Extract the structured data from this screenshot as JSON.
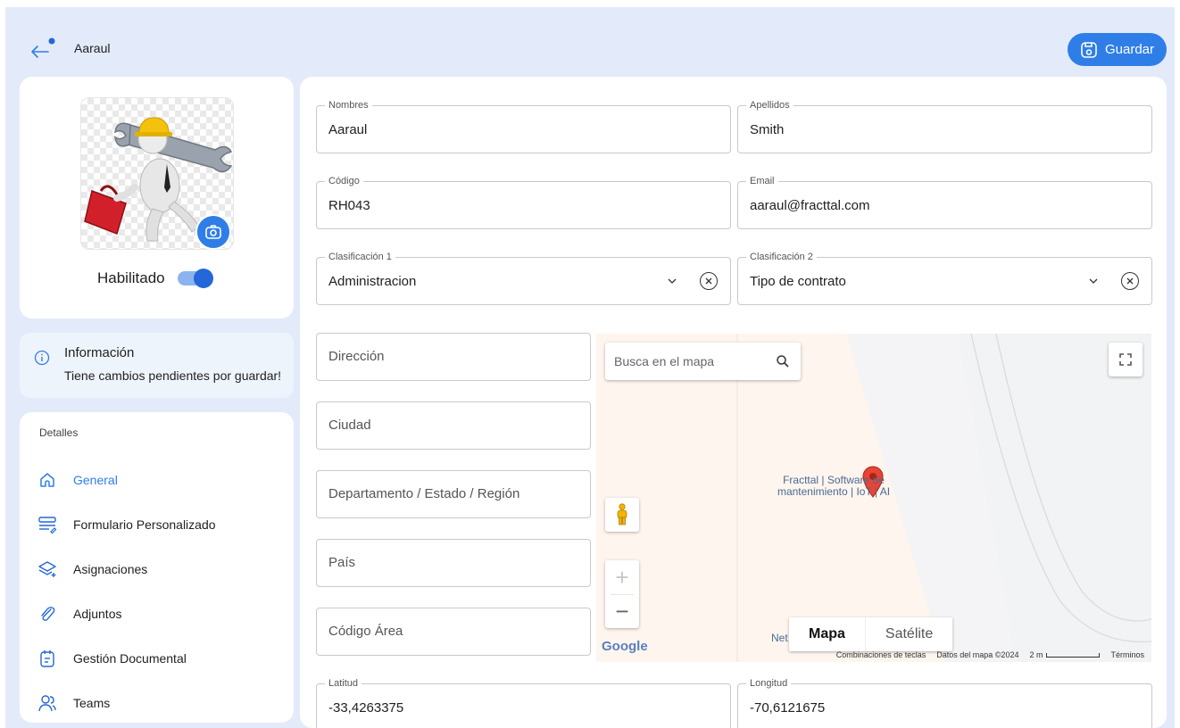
{
  "header": {
    "title": "Aaraul",
    "save_label": "Guardar"
  },
  "profile": {
    "enabled_label": "Habilitado",
    "enabled": true
  },
  "info": {
    "title": "Información",
    "text": "Tiene cambios pendientes por guardar!"
  },
  "nav": {
    "heading": "Detalles",
    "items": [
      {
        "label": "General",
        "icon": "home-icon",
        "active": true
      },
      {
        "label": "Formulario Personalizado",
        "icon": "form-icon",
        "active": false
      },
      {
        "label": "Asignaciones",
        "icon": "layers-icon",
        "active": false
      },
      {
        "label": "Adjuntos",
        "icon": "paperclip-icon",
        "active": false
      },
      {
        "label": "Gestión Documental",
        "icon": "document-calendar-icon",
        "active": false
      },
      {
        "label": "Teams",
        "icon": "users-icon",
        "active": false
      }
    ]
  },
  "form": {
    "nombres": {
      "label": "Nombres",
      "value": "Aaraul"
    },
    "apellidos": {
      "label": "Apellidos",
      "value": "Smith"
    },
    "codigo": {
      "label": "Código",
      "value": "RH043"
    },
    "email": {
      "label": "Email",
      "value": "aaraul@fracttal.com"
    },
    "clasificacion1": {
      "label": "Clasificación 1",
      "value": "Administracion"
    },
    "clasificacion2": {
      "label": "Clasificación 2",
      "value": "Tipo de contrato"
    },
    "direccion": {
      "placeholder": "Dirección"
    },
    "ciudad": {
      "placeholder": "Ciudad"
    },
    "departamento": {
      "placeholder": "Departamento / Estado / Región"
    },
    "pais": {
      "placeholder": "País"
    },
    "codigo_area": {
      "placeholder": "Código Área"
    },
    "latitud": {
      "label": "Latitud",
      "value": "-33,4263375"
    },
    "longitud": {
      "label": "Longitud",
      "value": "-70,6121675"
    }
  },
  "map": {
    "search_placeholder": "Busca en el mapa",
    "place_label": "Fracttal | Software de mantenimiento | IoT | AI",
    "net_label": "Net",
    "map_type_map": "Mapa",
    "map_type_satellite": "Satélite",
    "selected_type": "Mapa",
    "google_logo": "Google",
    "shortcuts": "Combinaciones de teclas",
    "map_data": "Datos del mapa ©2024",
    "scale": "2 m",
    "terms": "Términos"
  },
  "colors": {
    "accent": "#2f7ee8",
    "background": "#e3ebfa",
    "info_background": "#eef4fc"
  }
}
